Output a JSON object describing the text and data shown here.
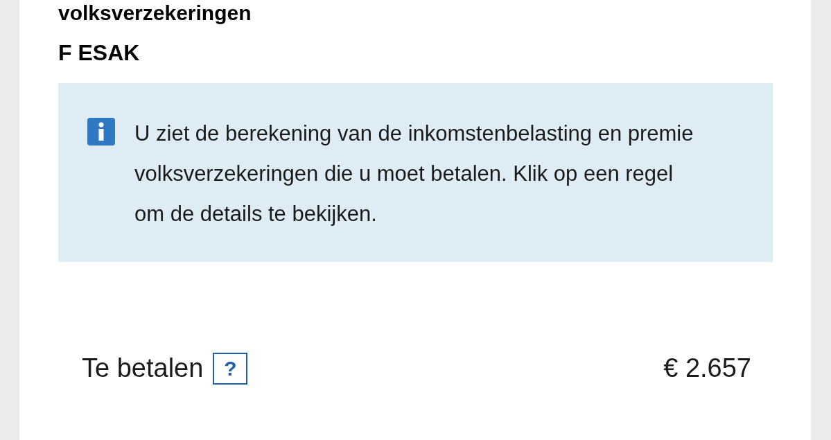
{
  "section_heading": "volksverzekeringen",
  "name": "F ESAK",
  "info": {
    "text": "U ziet de berekening van de inkomstenbelasting en premie volksverzekeringen die u moet betalen. Klik op een regel om de details te bekijken."
  },
  "total": {
    "label": "Te betalen",
    "help": "?",
    "amount": "€ 2.657"
  }
}
